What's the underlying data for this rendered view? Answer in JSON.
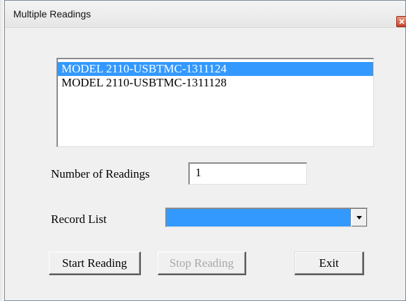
{
  "window": {
    "title": "Multiple Readings",
    "close_icon": "close-icon"
  },
  "device_list": {
    "items": [
      {
        "label": "MODEL 2110-USBTMC-1311124",
        "selected": true
      },
      {
        "label": "MODEL 2110-USBTMC-1311128",
        "selected": false
      }
    ]
  },
  "readings": {
    "label": "Number of Readings",
    "value": "1"
  },
  "record_list": {
    "label": "Record List",
    "value": "",
    "arrow_icon": "dropdown-arrow-icon"
  },
  "buttons": {
    "start": "Start Reading",
    "stop": "Stop Reading",
    "exit": "Exit"
  },
  "colors": {
    "selection": "#3399ff",
    "close_button": "#c7412a",
    "disabled_text": "#a8a8a8"
  }
}
